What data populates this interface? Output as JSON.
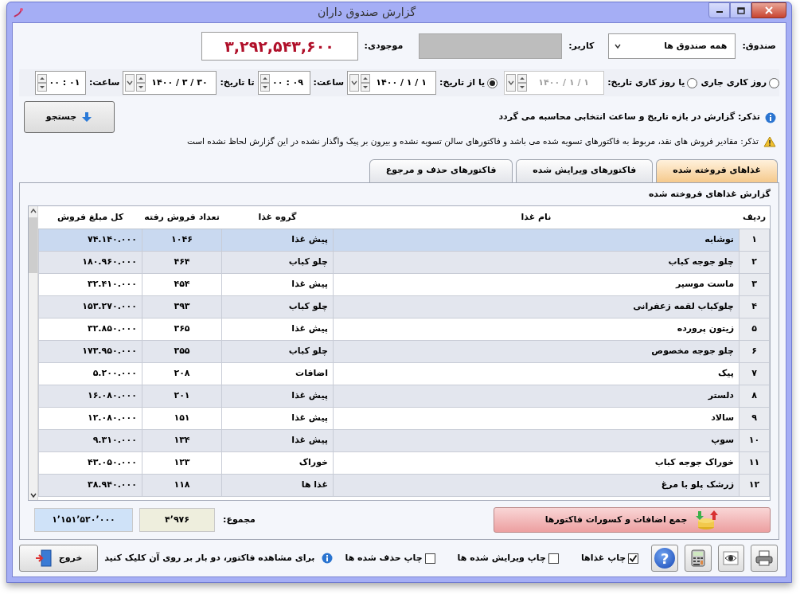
{
  "window": {
    "title": "گزارش صندوق داران"
  },
  "filters": {
    "fund_label": "صندوق:",
    "fund_value": "همه صندوق ها",
    "user_label": "کاربر:",
    "balance_label": "موجودی:",
    "balance": "۳,۲۹۲,۵۴۳,۶۰۰"
  },
  "date_modes": [
    {
      "label": "روز کاری جاری",
      "selected": false
    },
    {
      "label": "یا روز کاری تاریخ:",
      "selected": false,
      "date": "۱ / ۱ / ۱۴۰۰",
      "disabled": true
    },
    {
      "label": "یا از تاریخ:",
      "selected": true,
      "date": "۱ / ۱ / ۱۴۰۰",
      "time_label": "ساعت:",
      "time": "۰۹ : ۰۰",
      "to_label": "تا تاریخ:",
      "to_date": "۳۰ / ۳ / ۱۴۰۰",
      "to_time_label": "ساعت:",
      "to_time": "۰۱ : ۰۰"
    }
  ],
  "search_button": "جستجو",
  "notes": [
    {
      "kind": "info",
      "text": "تذکر: گزارش در بازه تاریخ و ساعت انتخابی محاسبه می گردد"
    },
    {
      "kind": "warning",
      "text": "تذکر: مقادیر فروش های نقد، مربوط به فاکتورهای تسویه شده می باشد و فاکتورهای سالن تسویه نشده و بیرون بر پیک واگذار نشده در این گزارش لحاظ نشده است"
    }
  ],
  "tabs": [
    {
      "label": "غذاهای فروخته شده",
      "selected": true
    },
    {
      "label": "فاکتورهای ویرایش شده",
      "selected": false
    },
    {
      "label": "فاکتورهای حذف و مرجوع",
      "selected": false
    }
  ],
  "group_title": "گزارش غذاهای فروخته شده",
  "table": {
    "columns": [
      "ردیف",
      "نام غذا",
      "گروه غذا",
      "تعداد فروش رفته",
      "کل مبلغ فروش"
    ],
    "rows": [
      {
        "cells": [
          "۱",
          "نوشابه",
          "پیش غذا",
          "۱۰۴۶",
          "۷۴.۱۴۰.۰۰۰"
        ],
        "selected": true
      },
      {
        "cells": [
          "۲",
          "چلو جوجه کباب",
          "چلو کباب",
          "۴۶۴",
          "۱۸۰.۹۶۰.۰۰۰"
        ],
        "selected": false
      },
      {
        "cells": [
          "۳",
          "ماست موسیر",
          "پیش غذا",
          "۴۵۴",
          "۳۲.۴۱۰.۰۰۰"
        ],
        "selected": false
      },
      {
        "cells": [
          "۴",
          "چلوکباب لقمه زعفرانی",
          "چلو کباب",
          "۳۹۳",
          "۱۵۳.۲۷۰.۰۰۰"
        ],
        "selected": false
      },
      {
        "cells": [
          "۵",
          "زیتون پرورده",
          "پیش غذا",
          "۳۶۵",
          "۳۲.۸۵۰.۰۰۰"
        ],
        "selected": false
      },
      {
        "cells": [
          "۶",
          "چلو جوجه مخصوص",
          "چلو کباب",
          "۳۵۵",
          "۱۷۳.۹۵۰.۰۰۰"
        ],
        "selected": false
      },
      {
        "cells": [
          "۷",
          "پیک",
          "اضافات",
          "۲۰۸",
          "۵.۲۰۰.۰۰۰"
        ],
        "selected": false
      },
      {
        "cells": [
          "۸",
          "دلستر",
          "پیش غذا",
          "۲۰۱",
          "۱۶.۰۸۰.۰۰۰"
        ],
        "selected": false
      },
      {
        "cells": [
          "۹",
          "سالاد",
          "پیش غذا",
          "۱۵۱",
          "۱۲.۰۸۰.۰۰۰"
        ],
        "selected": false
      },
      {
        "cells": [
          "۱۰",
          "سوپ",
          "پیش غذا",
          "۱۳۴",
          "۹.۳۱۰.۰۰۰"
        ],
        "selected": false
      },
      {
        "cells": [
          "۱۱",
          "خوراک جوجه کباب",
          "خوراک",
          "۱۲۳",
          "۴۳.۰۵۰.۰۰۰"
        ],
        "selected": false
      },
      {
        "cells": [
          "۱۲",
          "زرشک پلو با مرغ",
          "غذا ها",
          "۱۱۸",
          "۳۸.۹۴۰.۰۰۰"
        ],
        "selected": false
      }
    ]
  },
  "totals": {
    "button": "جمع اضافات و کسورات فاکتورها",
    "label": "مجموع:",
    "count": "۴٬۹۷۶",
    "amount": "۱٬۱۵۱٬۵۲۰٬۰۰۰"
  },
  "help_button": "?",
  "print_options": [
    {
      "label": "چاپ غذاها",
      "checked": true
    },
    {
      "label": "چاپ ویرایش شده ها",
      "checked": false
    },
    {
      "label": "چاپ حذف شده ها",
      "checked": false
    }
  ],
  "hint": "برای مشاهده فاکتور، دو بار بر روی آن کلیک کنید",
  "exit_button": "خروج"
}
